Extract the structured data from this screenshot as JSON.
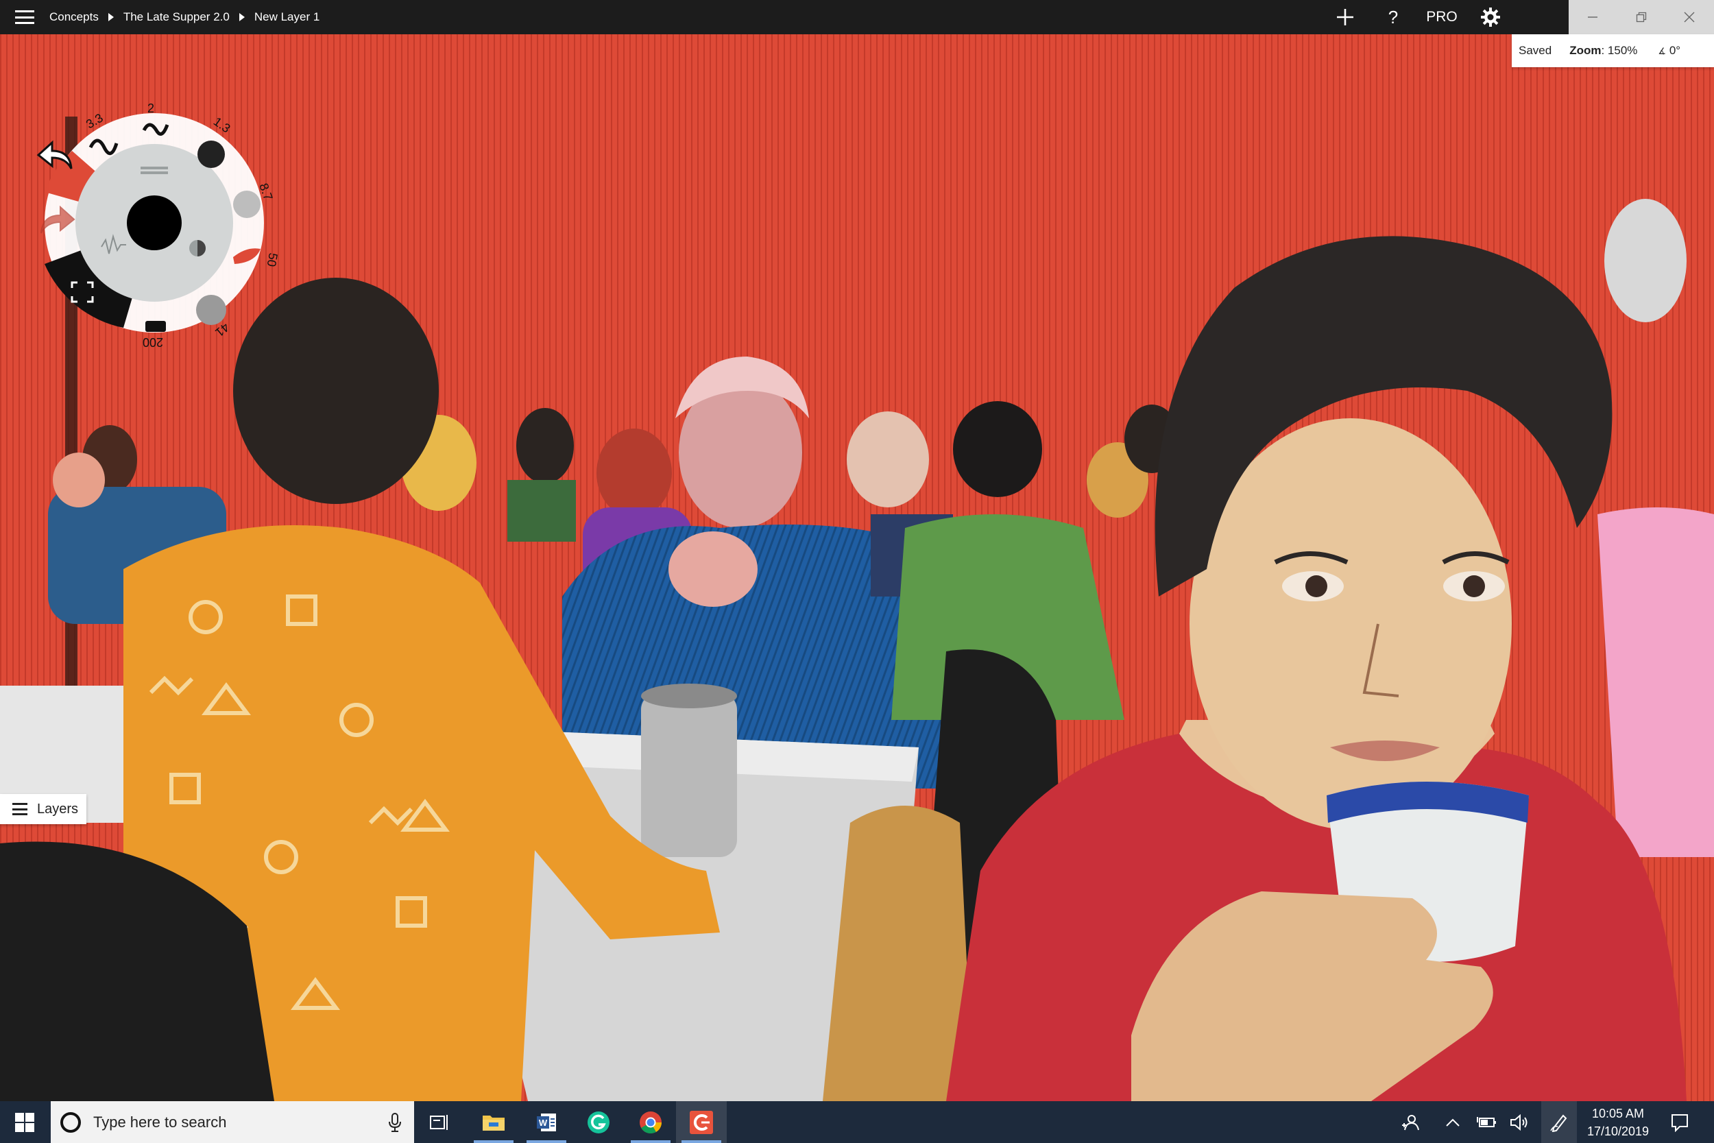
{
  "titlebar": {
    "breadcrumb": [
      "Concepts",
      "The Late Supper 2.0",
      "New Layer 1"
    ],
    "pro_label": "PRO",
    "add_icon": "plus-icon",
    "help_label": "?",
    "settings_icon": "gear-icon",
    "window_controls": [
      "minimize-icon",
      "restore-icon",
      "close-icon"
    ]
  },
  "status": {
    "saved": "Saved",
    "zoom_label": "Zoom",
    "zoom_value": ": 150%",
    "angle": "0°"
  },
  "brush_wheel": {
    "sizes": {
      "top_left": "3.3",
      "top": "2",
      "upper_right": "1.3",
      "right": "8.7",
      "lower_right": "50",
      "bottom_right": "41",
      "bottom": "200"
    },
    "active_color": "#000000",
    "accent_color": "#e0432e",
    "undo_icon": "undo-arrow-icon",
    "redo_icon": "redo-arrow-icon",
    "fullscreen_icon": "fullscreen-icon"
  },
  "layers": {
    "label": "Layers",
    "icon": "layers-icon"
  },
  "taskbar": {
    "search_placeholder": "Type here to search",
    "apps": [
      "task-view-icon",
      "file-explorer-icon",
      "word-icon",
      "grammarly-icon",
      "chrome-icon",
      "concepts-icon"
    ],
    "time": "10:05 AM",
    "date": "17/10/2019"
  },
  "colors": {
    "wall": "#de4a37",
    "titlebar": "#1c1c1c",
    "taskbar": "#1d2a3c"
  }
}
